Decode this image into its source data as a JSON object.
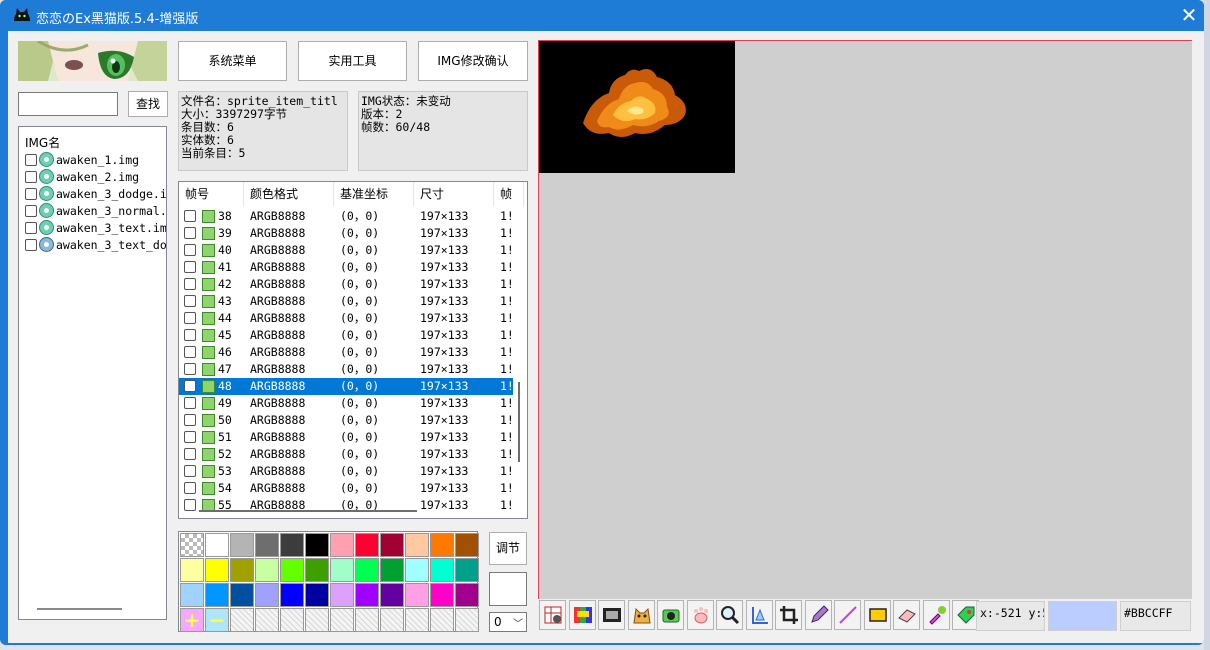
{
  "window": {
    "title": "恋恋のEx黑猫版.5.4-增强版",
    "close_glyph": "✕"
  },
  "search": {
    "value": "",
    "button_label": "查找"
  },
  "buttons": {
    "system_menu": "系统菜单",
    "tools": "实用工具",
    "img_confirm": "IMG修改确认",
    "adjust": "调节"
  },
  "file_list": {
    "header": "IMG名",
    "items": [
      "awaken_1.img",
      "awaken_2.img",
      "awaken_3_dodge.i",
      "awaken_3_normal.",
      "awaken_3_text.im",
      "awaken_3_text_do"
    ]
  },
  "info_left": {
    "line1": "文件名：sprite_item_titl",
    "line2": "大小：3397297字节",
    "line3": "条目数：6",
    "line4": "实体数：6",
    "line5": "当前条目：5"
  },
  "info_right": {
    "line1": "IMG状态：未变动",
    "line2": "版本：2",
    "line3": "帧数：60/48"
  },
  "frame_table": {
    "columns": [
      "帧号",
      "颜色格式",
      "基准坐标",
      "尺寸",
      "帧"
    ],
    "selected_frame": "48",
    "rows": [
      {
        "n": "38",
        "fmt": "ARGB8888",
        "pos": "(0，0)",
        "size": "197×133",
        "extra": "1!"
      },
      {
        "n": "39",
        "fmt": "ARGB8888",
        "pos": "(0，0)",
        "size": "197×133",
        "extra": "1!"
      },
      {
        "n": "40",
        "fmt": "ARGB8888",
        "pos": "(0，0)",
        "size": "197×133",
        "extra": "1!"
      },
      {
        "n": "41",
        "fmt": "ARGB8888",
        "pos": "(0，0)",
        "size": "197×133",
        "extra": "1!"
      },
      {
        "n": "42",
        "fmt": "ARGB8888",
        "pos": "(0，0)",
        "size": "197×133",
        "extra": "1!"
      },
      {
        "n": "43",
        "fmt": "ARGB8888",
        "pos": "(0，0)",
        "size": "197×133",
        "extra": "1!"
      },
      {
        "n": "44",
        "fmt": "ARGB8888",
        "pos": "(0，0)",
        "size": "197×133",
        "extra": "1!"
      },
      {
        "n": "45",
        "fmt": "ARGB8888",
        "pos": "(0，0)",
        "size": "197×133",
        "extra": "1!"
      },
      {
        "n": "46",
        "fmt": "ARGB8888",
        "pos": "(0，0)",
        "size": "197×133",
        "extra": "1!"
      },
      {
        "n": "47",
        "fmt": "ARGB8888",
        "pos": "(0，0)",
        "size": "197×133",
        "extra": "1!"
      },
      {
        "n": "48",
        "fmt": "ARGB8888",
        "pos": "(0，0)",
        "size": "197×133",
        "extra": "1!"
      },
      {
        "n": "49",
        "fmt": "ARGB8888",
        "pos": "(0，0)",
        "size": "197×133",
        "extra": "1!"
      },
      {
        "n": "50",
        "fmt": "ARGB8888",
        "pos": "(0，0)",
        "size": "197×133",
        "extra": "1!"
      },
      {
        "n": "51",
        "fmt": "ARGB8888",
        "pos": "(0，0)",
        "size": "197×133",
        "extra": "1!"
      },
      {
        "n": "52",
        "fmt": "ARGB8888",
        "pos": "(0，0)",
        "size": "197×133",
        "extra": "1!"
      },
      {
        "n": "53",
        "fmt": "ARGB8888",
        "pos": "(0，0)",
        "size": "197×133",
        "extra": "1!"
      },
      {
        "n": "54",
        "fmt": "ARGB8888",
        "pos": "(0，0)",
        "size": "197×133",
        "extra": "1!"
      },
      {
        "n": "55",
        "fmt": "ARGB8888",
        "pos": "(0，0)",
        "size": "197×133",
        "extra": "1!"
      }
    ]
  },
  "palette": {
    "colors": [
      "checker",
      "#ffffff",
      "#b4b4b4",
      "#6e6e6e",
      "#3c3c3c",
      "#000000",
      "#ffa0b0",
      "#ff0032",
      "#a00032",
      "#ffc8a0",
      "#ff7800",
      "#a05000",
      "#ffffa0",
      "#ffff00",
      "#a0a000",
      "#c8ffa0",
      "#64ff00",
      "#3ca000",
      "#a0ffc8",
      "#00ff50",
      "#00a032",
      "#a0ffff",
      "#00ffd2",
      "#00a08c",
      "#a0d2ff",
      "#0096ff",
      "#0050a0",
      "#a0a0ff",
      "#0000ff",
      "#0000a0",
      "#dca0ff",
      "#a000ff",
      "#6400a0",
      "#ffa0e6",
      "#ff00c8",
      "#a0008c",
      "add",
      "remove",
      "empty",
      "empty",
      "empty",
      "empty",
      "empty",
      "empty",
      "empty",
      "empty",
      "empty",
      "empty"
    ],
    "add_glyph": "+",
    "remove_glyph": "−"
  },
  "zoom_select": {
    "value": "0"
  },
  "status": {
    "coords": "x:-521 y:5",
    "hex_color": "#BBCCFF",
    "picked_color": "#bbccff"
  },
  "toolbar_icons": [
    "layers-icon",
    "palette-icon",
    "film-strip-icon",
    "cat-tool-icon",
    "camera-icon",
    "paw-icon",
    "magnifier-icon",
    "align-icon",
    "crop-icon",
    "pencil-icon",
    "line-icon",
    "rectangle-icon",
    "eraser-icon",
    "eyedropper-icon",
    "fill-tag-icon"
  ]
}
